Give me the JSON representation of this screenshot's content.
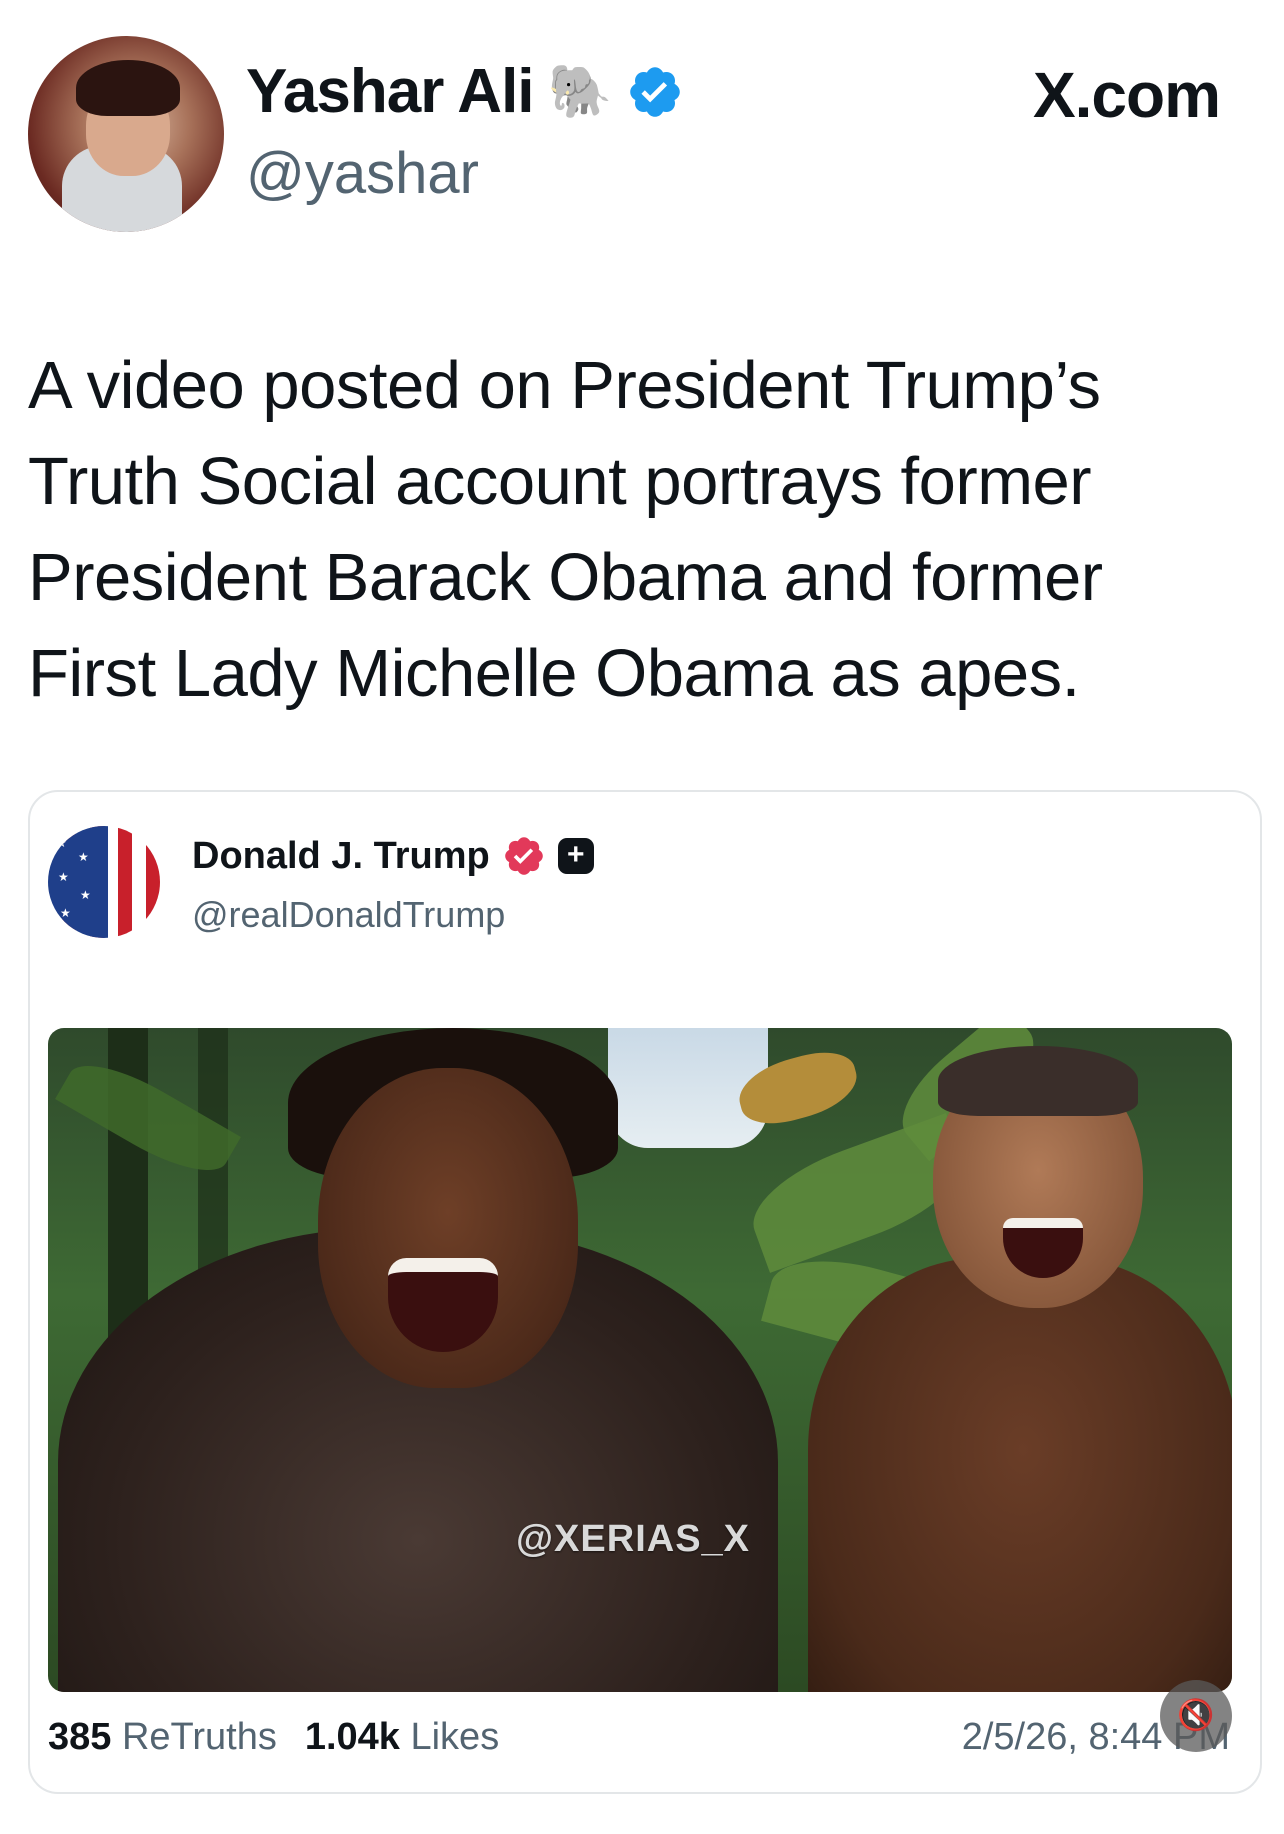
{
  "tweet": {
    "author_name": "Yashar Ali",
    "author_handle": "@yashar",
    "name_emoji": "elephant-emoji",
    "source_label": "X.com",
    "text": "A video posted on President Trump’s Truth Social account portrays former President Barack Obama and former First Lady Michelle Obama as apes.",
    "verified_color": "#1d9bf0"
  },
  "embedded_post": {
    "author_name": "Donald J. Trump",
    "author_handle": "@realDonaldTrump",
    "badge_color": "#e2395a",
    "plus_badge": "+",
    "media_watermark": "@XERIAS_X",
    "retruths_count": "385",
    "retruths_label": "ReTruths",
    "likes_count": "1.04k",
    "likes_label": "Likes",
    "timestamp": "2/5/26, 8:44 PM",
    "mute_icon": "speaker-muted-icon"
  }
}
